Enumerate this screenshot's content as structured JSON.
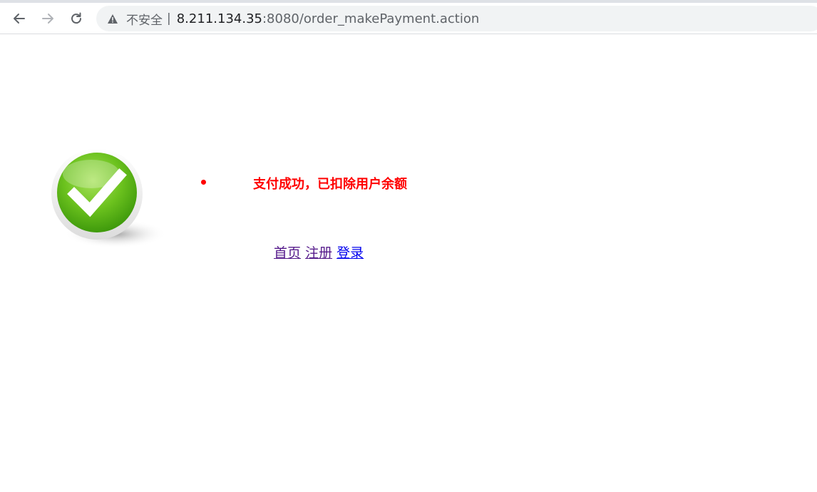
{
  "browser": {
    "security_label": "不安全",
    "separator": "|",
    "url_host": "8.211.134.35",
    "url_rest": ":8080/order_makePayment.action",
    "icons": {
      "back": "back-arrow-icon",
      "forward": "forward-arrow-icon",
      "reload": "reload-icon",
      "warning": "warning-icon"
    }
  },
  "page": {
    "message": "支付成功，已扣除用户余额",
    "message_color": "#ff0000",
    "links": [
      {
        "label": "首页"
      },
      {
        "label": "注册"
      },
      {
        "label": "登录"
      }
    ],
    "image": "success-checkmark-icon"
  }
}
